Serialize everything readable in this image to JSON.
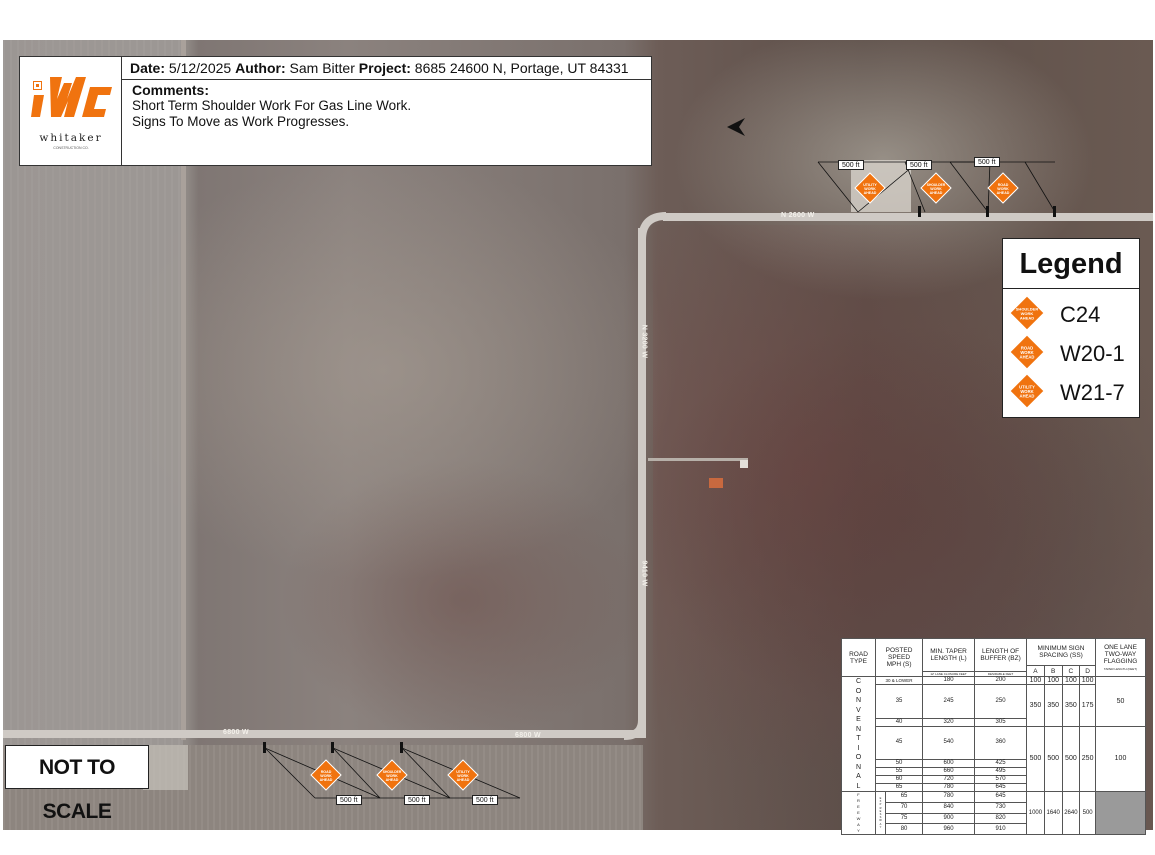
{
  "info": {
    "date_label": "Date:",
    "date": "5/12/2025",
    "author_label": "Author:",
    "author": "Sam Bitter",
    "project_label": "Project:",
    "project": "8685 24600 N, Portage, UT 84331",
    "comments_label": "Comments:",
    "comment_lines": [
      "Short Term Shoulder Work For Gas Line Work.",
      "Signs To Move as Work Progresses."
    ]
  },
  "logo": {
    "text": "whitaker",
    "sub": "CONSTRUCTION CO.",
    "brand_color": "#f0730f"
  },
  "legend": {
    "title": "Legend",
    "items": [
      {
        "code": "C24",
        "sign_text": [
          "SHOULDER",
          "WORK",
          "AHEAD"
        ]
      },
      {
        "code": "W20-1",
        "sign_text": [
          "ROAD",
          "WORK",
          "AHEAD"
        ]
      },
      {
        "code": "W21-7",
        "sign_text": [
          "UTILITY",
          "WORK",
          "AHEAD"
        ]
      }
    ],
    "sign_color": "#f0730f"
  },
  "not_to_scale": "NOT TO SCALE",
  "top_distances": [
    "500 ft",
    "500 ft",
    "500 ft"
  ],
  "bottom_distances": [
    "500 ft",
    "500 ft",
    "500 ft"
  ],
  "top_signs": [
    {
      "name": "utility",
      "text": [
        "UTILITY",
        "WORK",
        "AHEAD"
      ]
    },
    {
      "name": "shoulder",
      "text": [
        "SHOULDER",
        "WORK",
        "AHEAD"
      ]
    },
    {
      "name": "road",
      "text": [
        "ROAD",
        "WORK",
        "AHEAD"
      ]
    }
  ],
  "bottom_signs": [
    {
      "name": "road",
      "text": [
        "ROAD",
        "WORK",
        "AHEAD"
      ]
    },
    {
      "name": "shoulder",
      "text": [
        "SHOULDER",
        "WORK",
        "AHEAD"
      ]
    },
    {
      "name": "utility",
      "text": [
        "UTILITY",
        "WORK",
        "AHEAD"
      ]
    }
  ],
  "road_labels": {
    "top": "N 2600 W",
    "vertical_upper": "N 3200 W",
    "vertical_lower": "9410 W",
    "bottom_left": "6800 W",
    "bottom_right": "6800 W"
  },
  "table": {
    "headers": {
      "road_type": [
        "ROAD",
        "TYPE"
      ],
      "posted_speed": [
        "POSTED",
        "SPEED",
        "MPH (S)"
      ],
      "taper": [
        "MIN. TAPER",
        "LENGTH (L)"
      ],
      "taper_sub": "12' LANE CLOSURE FEET",
      "buffer": [
        "LENGTH OF",
        "BUFFER (BZ)"
      ],
      "buffer_sub": "DESIRABLE FEET",
      "spacing": [
        "MINIMUM SIGN",
        "SPACING (SS)"
      ],
      "spacing_cols": [
        "A",
        "B",
        "C",
        "D"
      ],
      "flagging": [
        "ONE LANE",
        "TWO-WAY",
        "FLAGGING"
      ],
      "flagging_sub": "TAPER LENGTH (FEET)"
    },
    "conventional_label": [
      "C",
      "O",
      "N",
      "V",
      "E",
      "N",
      "T",
      "I",
      "O",
      "N",
      "A",
      "L"
    ],
    "freeway_label": [
      "F",
      "R",
      "E",
      "E",
      "W",
      "A",
      "Y"
    ],
    "freeway_sub": [
      "E",
      "X",
      "P",
      "R",
      "E",
      "S",
      "S",
      "W",
      "A",
      "Y"
    ],
    "rows": [
      {
        "speed": "30 & LOWER",
        "taper": "180",
        "buffer": "200"
      },
      {
        "speed": "35",
        "taper": "245",
        "buffer": "250"
      },
      {
        "speed": "40",
        "taper": "320",
        "buffer": "305"
      },
      {
        "speed": "45",
        "taper": "540",
        "buffer": "360"
      },
      {
        "speed": "50",
        "taper": "600",
        "buffer": "425"
      },
      {
        "speed": "55",
        "taper": "660",
        "buffer": "495"
      },
      {
        "speed": "60",
        "taper": "720",
        "buffer": "570"
      },
      {
        "speed": "65",
        "taper": "780",
        "buffer": "645"
      },
      {
        "speed": "65",
        "taper": "780",
        "buffer": "645"
      },
      {
        "speed": "70",
        "taper": "840",
        "buffer": "730"
      },
      {
        "speed": "75",
        "taper": "900",
        "buffer": "820"
      },
      {
        "speed": "80",
        "taper": "960",
        "buffer": "910"
      }
    ],
    "spacing_groups": [
      {
        "top": [
          "100",
          "100",
          "100",
          "100"
        ],
        "bottom": [
          "350",
          "350",
          "350",
          "175"
        ],
        "flag": "50"
      },
      {
        "values": [
          "500",
          "500",
          "500",
          "250"
        ],
        "flag": "100"
      },
      {
        "values": [
          "1000",
          "1640",
          "2640",
          "500"
        ]
      }
    ]
  }
}
